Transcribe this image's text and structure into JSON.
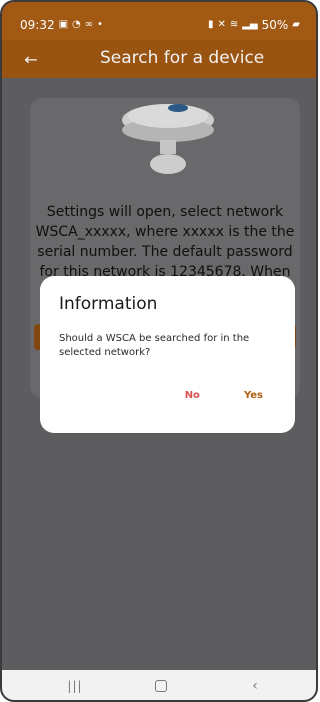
{
  "status_bar": {
    "time": "09:32",
    "battery": "50%",
    "icons_left": [
      "gallery-icon",
      "whatsapp-icon",
      "voicemail-icon",
      "dot-icon"
    ],
    "icons_right": [
      "lock-icon",
      "mute-icon",
      "wifi-icon",
      "signal-icon",
      "battery-icon"
    ]
  },
  "appbar": {
    "title": "Search for a device",
    "back_icon": "arrow-left-icon"
  },
  "card": {
    "text": "Settings will open, select network WSCA_xxxxx, where xxxxx is the the serial number. The default password for this network is 12345678. When you are connected to the network, return with the"
  },
  "dialog": {
    "title": "Information",
    "message": "Should a WSCA be searched for in the selected network?",
    "no_label": "No",
    "yes_label": "Yes"
  },
  "navbar": {
    "items": [
      "recent-apps-icon",
      "home-icon",
      "back-icon"
    ]
  },
  "colors": {
    "primary": "#a25914",
    "no_button": "#d9534f",
    "yes_button": "#b05f12",
    "dialog_bg": "#ffffff"
  }
}
